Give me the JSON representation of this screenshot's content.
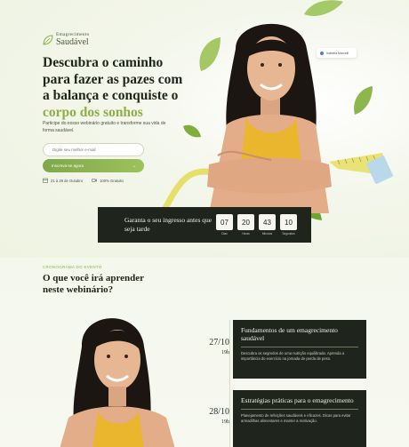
{
  "brand": {
    "small": "Emagrecimento",
    "big": "Saudável"
  },
  "hero": {
    "headline_lines": [
      "Descubra o caminho",
      "para fazer as pazes com",
      "a balança e conquiste o"
    ],
    "headline_accent": "corpo dos sonhos",
    "subtitle": "Participe do nosso webinário gratuito e transforme sua vida de forma saudável.",
    "email_placeholder": "Digite seu melhor e-mail",
    "cta_label": "Inscreva-se agora",
    "cta_arrow": "→",
    "dates": "21 à 29 de Outubro",
    "price": "100% Gratuito",
    "name_tag": "Isabella Marcelli"
  },
  "countdown": {
    "text": "Garanta o seu ingresso antes que seja tarde",
    "items": [
      {
        "value": "07",
        "label": "Dias"
      },
      {
        "value": "20",
        "label": "Horas"
      },
      {
        "value": "43",
        "label": "Minutos"
      },
      {
        "value": "10",
        "label": "Segundos"
      }
    ]
  },
  "agenda": {
    "kicker": "CRONOGRAMA DO EVENTO",
    "title": "O que você irá aprender neste webinário?",
    "sessions": [
      {
        "date": "27/10",
        "hour": "19h",
        "title": "Fundamentos de um emagrecimento saudável",
        "description": "Descubra os segredos de uma nutrição equilibrada. Aprenda a importância do exercício na jornada de perda de peso."
      },
      {
        "date": "28/10",
        "hour": "19h",
        "title": "Estratégias práticas para o emagrecimento",
        "description": "Planejamento de refeições saudáveis e eficazes. Dicas para evitar armadilhas alimentares e manter a motivação."
      }
    ]
  },
  "colors": {
    "accent": "#8cb045",
    "dark": "#1f251c",
    "background": "#f6f8ef"
  }
}
